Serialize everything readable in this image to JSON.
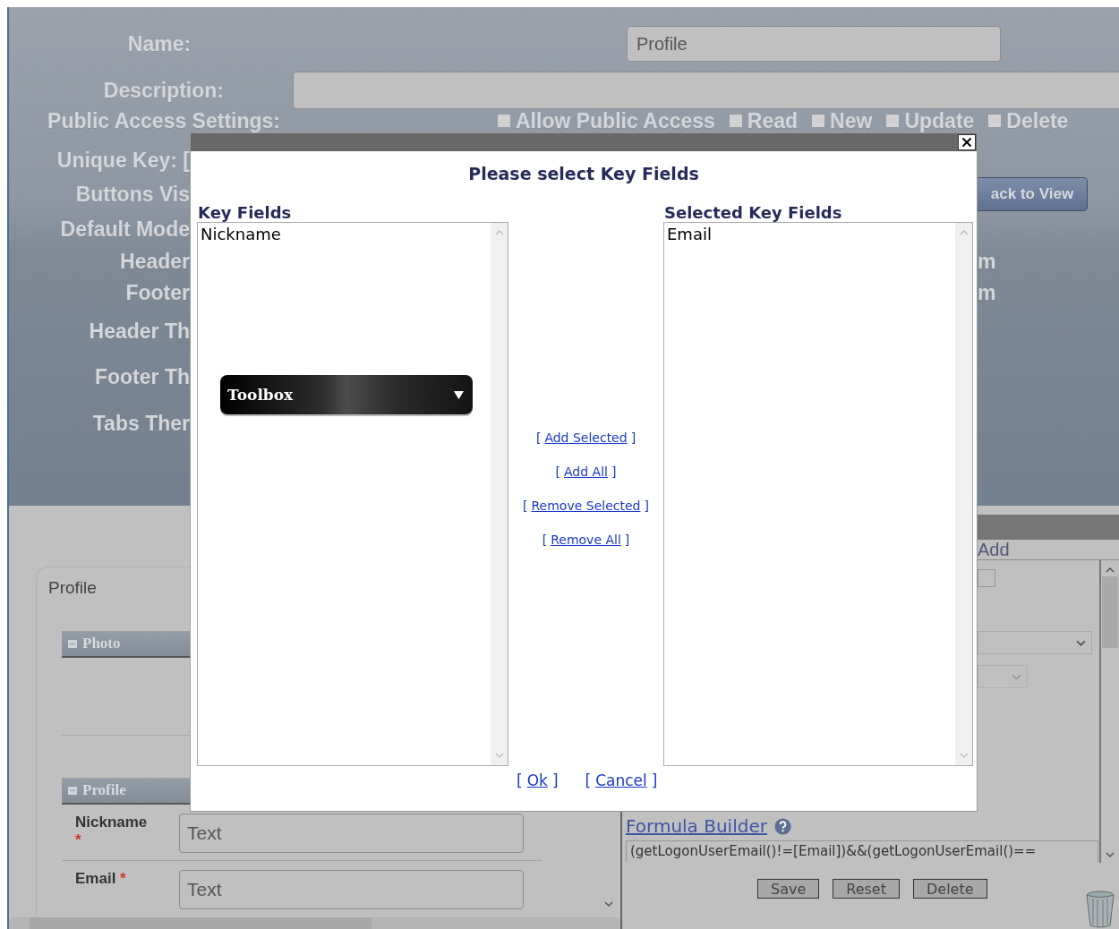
{
  "form": {
    "name": {
      "label": "Name:",
      "value": "Profile"
    },
    "description": {
      "label": "Description:"
    },
    "public_access": {
      "label": "Public Access Settings:",
      "options": [
        {
          "label": "Allow Public Access",
          "checked": false
        },
        {
          "label": "Read",
          "checked": false
        },
        {
          "label": "New",
          "checked": false
        },
        {
          "label": "Update",
          "checked": false
        },
        {
          "label": "Delete",
          "checked": false
        }
      ]
    },
    "labels": [
      "Unique Key: [",
      "Buttons Vis",
      "Default Mode",
      "Header",
      "Footer",
      "Header Th",
      "Footer Th",
      "Tabs Ther"
    ],
    "back_button": "ack to View",
    "right_fragments": [
      "m",
      "m"
    ]
  },
  "designer": {
    "title": "Profile",
    "sections": [
      {
        "title": "Photo"
      },
      {
        "title": "Profile"
      }
    ],
    "fields": [
      {
        "label": "Nickname",
        "mark": "*",
        "placeholder": "Text"
      },
      {
        "label": "Email",
        "mark": "*",
        "placeholder": "Text"
      }
    ]
  },
  "properties": {
    "tab": "Add",
    "formula_link": "Formula Builder",
    "formula": "(getLogonUserEmail()!=[Email])&&(getLogonUserEmail()==",
    "buttons": [
      "Save",
      "Reset",
      "Delete"
    ]
  },
  "dialog": {
    "title": "Please select Key Fields",
    "left_list": {
      "label": "Key Fields",
      "items": [
        "Nickname"
      ]
    },
    "right_list": {
      "label": "Selected Key Fields",
      "items": [
        "Email"
      ]
    },
    "actions": [
      {
        "open": "[",
        "label": "Add Selected",
        "close": "]"
      },
      {
        "open": "[",
        "label": "Add All",
        "close": "]"
      },
      {
        "open": "[",
        "label": "Remove Selected",
        "close": "]"
      },
      {
        "open": "[",
        "label": "Remove All",
        "close": "]"
      }
    ],
    "footer": [
      {
        "open": "[",
        "label": "Ok",
        "close": "]"
      },
      {
        "open": "[",
        "label": "Cancel",
        "close": "]"
      }
    ],
    "toolbox": {
      "label": "Toolbox"
    }
  }
}
